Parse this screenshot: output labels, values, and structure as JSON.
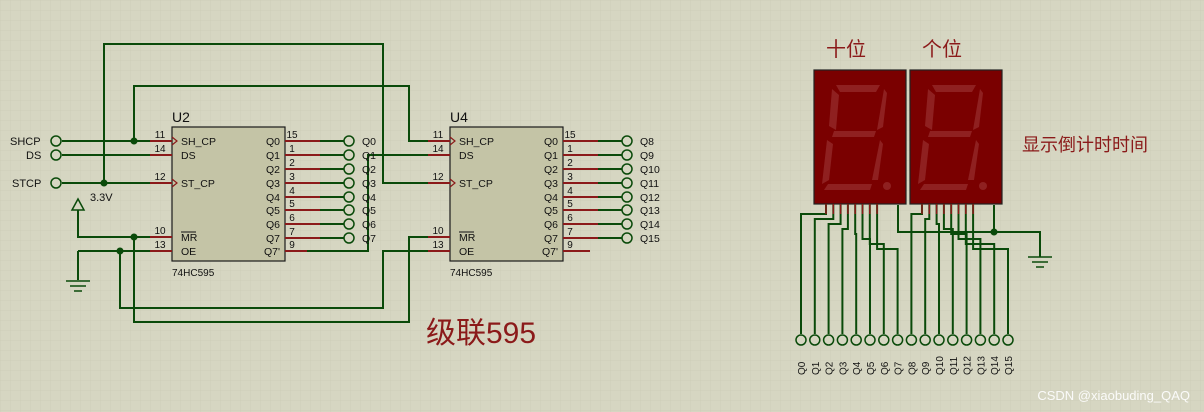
{
  "u2": {
    "ref": "U2",
    "part": "74HC595",
    "left_pins": [
      {
        "num": "11",
        "name": "SH_CP"
      },
      {
        "num": "14",
        "name": "DS"
      },
      {
        "num": "12",
        "name": "ST_CP"
      },
      {
        "num": "10",
        "name": "MR"
      },
      {
        "num": "13",
        "name": "OE"
      }
    ],
    "right_pins": [
      {
        "num": "15",
        "name": "Q0"
      },
      {
        "num": "1",
        "name": "Q1"
      },
      {
        "num": "2",
        "name": "Q2"
      },
      {
        "num": "3",
        "name": "Q3"
      },
      {
        "num": "4",
        "name": "Q4"
      },
      {
        "num": "5",
        "name": "Q5"
      },
      {
        "num": "6",
        "name": "Q6"
      },
      {
        "num": "7",
        "name": "Q7"
      },
      {
        "num": "9",
        "name": "Q7'"
      }
    ],
    "outputs": [
      "Q0",
      "Q1",
      "Q2",
      "Q3",
      "Q4",
      "Q5",
      "Q6",
      "Q7"
    ]
  },
  "u4": {
    "ref": "U4",
    "part": "74HC595",
    "left_pins": [
      {
        "num": "11",
        "name": "SH_CP"
      },
      {
        "num": "14",
        "name": "DS"
      },
      {
        "num": "12",
        "name": "ST_CP"
      },
      {
        "num": "10",
        "name": "MR"
      },
      {
        "num": "13",
        "name": "OE"
      }
    ],
    "right_pins": [
      {
        "num": "15",
        "name": "Q0"
      },
      {
        "num": "1",
        "name": "Q1"
      },
      {
        "num": "2",
        "name": "Q2"
      },
      {
        "num": "3",
        "name": "Q3"
      },
      {
        "num": "4",
        "name": "Q4"
      },
      {
        "num": "5",
        "name": "Q5"
      },
      {
        "num": "6",
        "name": "Q6"
      },
      {
        "num": "7",
        "name": "Q7"
      },
      {
        "num": "9",
        "name": "Q7'"
      }
    ],
    "outputs": [
      "Q8",
      "Q9",
      "Q10",
      "Q11",
      "Q12",
      "Q13",
      "Q14",
      "Q15"
    ]
  },
  "inputs": [
    "SHCP",
    "DS",
    "STCP"
  ],
  "power_label": "3.3V",
  "display": {
    "tens_label": "十位",
    "units_label": "个位",
    "caption": "显示倒计时时间"
  },
  "bottom_terminals": [
    "Q0",
    "Q1",
    "Q2",
    "Q3",
    "Q4",
    "Q5",
    "Q6",
    "Q7",
    "Q8",
    "Q9",
    "Q10",
    "Q11",
    "Q12",
    "Q13",
    "Q14",
    "Q15"
  ],
  "caption": "级联595",
  "watermark": "CSDN @xiaobuding_QAQ",
  "colors": {
    "background": "#d6d6c2",
    "wire": "#0a4a0a",
    "chip": "#c4c4a6",
    "pin": "#8b1a1a",
    "display": "#7a0000",
    "caption": "#8b1a1a"
  }
}
